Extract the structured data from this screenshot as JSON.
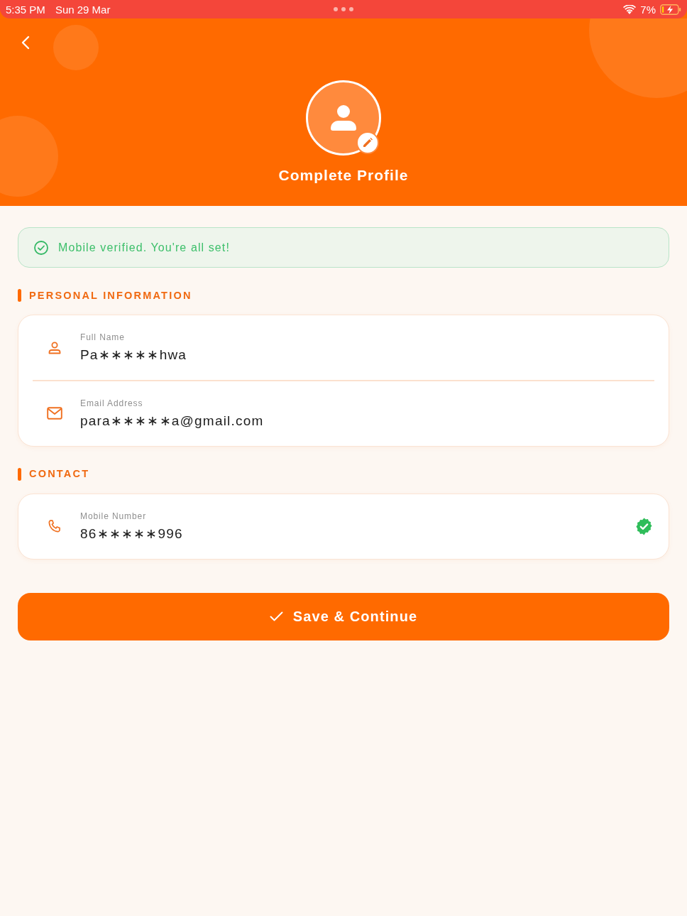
{
  "status_bar": {
    "time": "5:35 PM",
    "date": "Sun 29 Mar",
    "battery": "7%"
  },
  "header": {
    "title": "Complete Profile"
  },
  "banner": {
    "text": "Mobile verified. You're all set!"
  },
  "sections": [
    {
      "title": "PERSONAL INFORMATION",
      "fields": [
        {
          "kind": "name",
          "label": "Full Name",
          "value": "Pa∗∗∗∗∗hwa",
          "verified": false
        },
        {
          "kind": "email",
          "label": "Email Address",
          "value": "para∗∗∗∗∗a@gmail.com",
          "verified": false
        }
      ]
    },
    {
      "title": "CONTACT",
      "fields": [
        {
          "kind": "phone",
          "label": "Mobile Number",
          "value": "86∗∗∗∗∗996",
          "verified": true
        }
      ]
    }
  ],
  "button": {
    "label": "Save & Continue"
  }
}
